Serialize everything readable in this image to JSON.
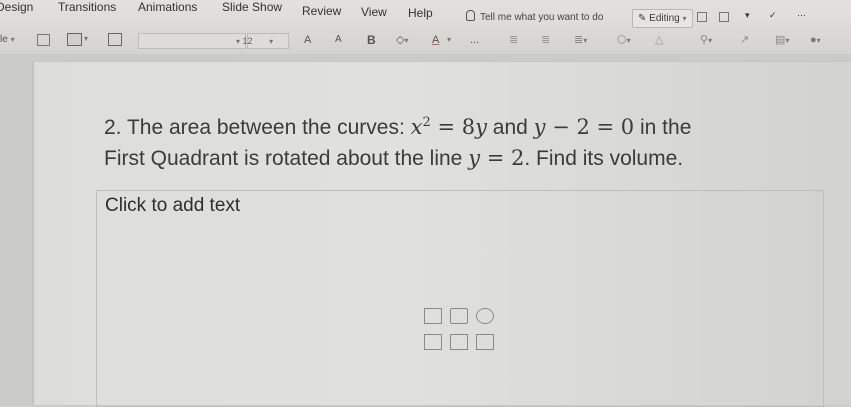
{
  "menubar": {
    "tabs": [
      "Design",
      "Transitions",
      "Animations",
      "Slide Show",
      "Review",
      "View",
      "Help"
    ],
    "tell_me": "Tell me what you want to do",
    "editing": "Editing"
  },
  "toolbar": {
    "layout_label": "le",
    "font_size": "12",
    "increase_font": "A",
    "decrease_font": "A",
    "bold": "B",
    "font_color": "A",
    "more": "..."
  },
  "slide": {
    "title_line1_prefix": "2. The area between the curves: ",
    "title_x": "x",
    "title_exp": "2",
    "title_eq1": " = 8",
    "title_y": "y",
    "title_and": " and ",
    "title_y2": "y",
    "title_eq2": " − 2 = 0",
    "title_line1_suffix": " in the",
    "title_line2_prefix": "First Quadrant is rotated about the line ",
    "title_y3": "y",
    "title_eq3": " = 2",
    "title_line2_suffix": ". Find its volume.",
    "body_placeholder": "Click to add text"
  }
}
